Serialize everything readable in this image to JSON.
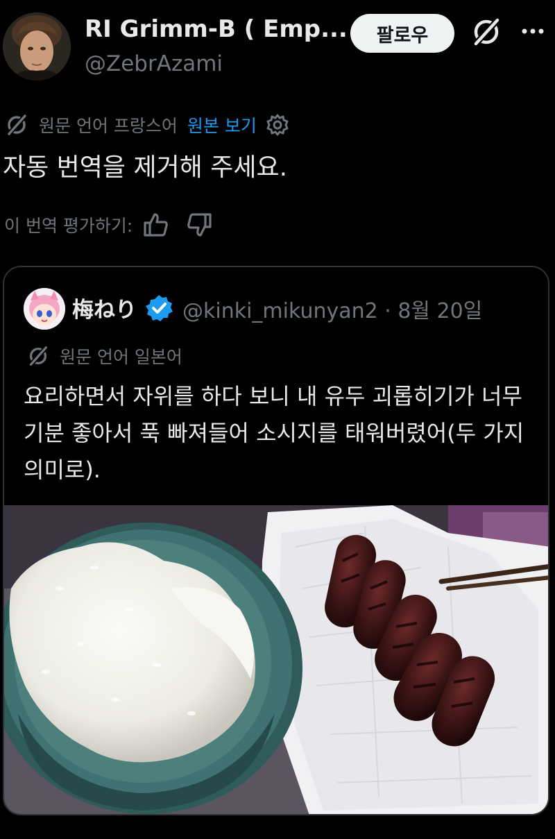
{
  "author": {
    "display_name": "RI Grimm-B ( Emp...",
    "handle": "@ZebrAzami"
  },
  "actions": {
    "follow_label": "팔로우",
    "grok_icon": "grok-slash-icon",
    "more_icon": "more-dots-icon"
  },
  "translation": {
    "original_language": "원문 언어 프랑스어",
    "view_original": "원본 보기",
    "settings_icon": "gear-icon"
  },
  "tweet": {
    "text": "자동 번역을 제거해 주세요."
  },
  "rating": {
    "label": "이 번역 평가하기:",
    "thumbs_up_icon": "thumbs-up-icon",
    "thumbs_down_icon": "thumbs-down-icon"
  },
  "quoted": {
    "name": "梅ねり",
    "verified_icon": "verified-badge-icon",
    "handle_date": "@kinki_mikunyan2 · 8월 20일",
    "original_language": "원문 언어 일본어",
    "text": "요리하면서 자위를 하다 보니 내 유두 괴롭히기가 너무 기분 좋아서 푹 빠져들어 소시지를 태워버렸어(두 가지 의미로).",
    "photo_icon": "food-photo"
  },
  "colors": {
    "background": "#000000",
    "text": "#e7e9ea",
    "secondary": "#71767b",
    "link": "#1d9bf0",
    "border": "#2f3336",
    "follow_bg": "#eff3f4"
  }
}
